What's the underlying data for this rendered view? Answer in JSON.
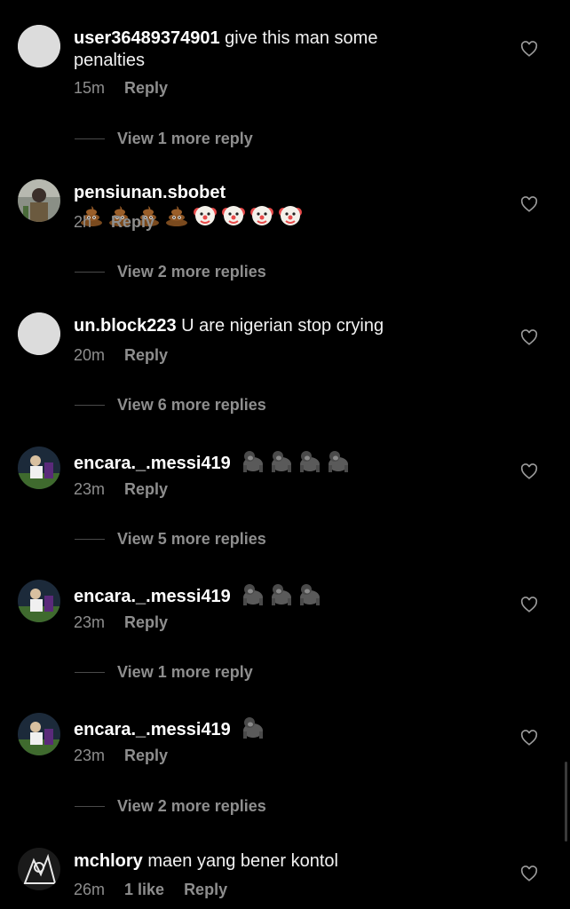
{
  "comments": [
    {
      "username": "user36489374901",
      "text": "give this man some penalties",
      "time": "15m",
      "likes": "",
      "reply_label": "Reply",
      "avatar": "default-avatar",
      "emojis": [],
      "view_more": "View 1 more reply"
    },
    {
      "username": "pensiunan.sbobet",
      "text": "",
      "time": "2h",
      "likes": "",
      "reply_label": "Reply",
      "avatar": "photo-avatar",
      "emojis": [
        "poop-emoji",
        "poop-emoji",
        "poop-emoji",
        "poop-emoji",
        "clown-emoji",
        "clown-emoji",
        "clown-emoji",
        "clown-emoji"
      ],
      "view_more": "View 2 more replies"
    },
    {
      "username": "un.block223",
      "text": "U are nigerian stop crying",
      "time": "20m",
      "likes": "",
      "reply_label": "Reply",
      "avatar": "default-avatar",
      "emojis": [],
      "view_more": "View 6 more replies"
    },
    {
      "username": "encara._.messi419",
      "text": "",
      "time": "23m",
      "likes": "",
      "reply_label": "Reply",
      "avatar": "photo-avatar",
      "emojis": [
        "gorilla-emoji",
        "gorilla-emoji",
        "gorilla-emoji",
        "gorilla-emoji"
      ],
      "view_more": "View 5 more replies"
    },
    {
      "username": "encara._.messi419",
      "text": "",
      "time": "23m",
      "likes": "",
      "reply_label": "Reply",
      "avatar": "photo-avatar",
      "emojis": [
        "gorilla-emoji",
        "gorilla-emoji",
        "gorilla-emoji"
      ],
      "view_more": "View 1 more reply"
    },
    {
      "username": "encara._.messi419",
      "text": "",
      "time": "23m",
      "likes": "",
      "reply_label": "Reply",
      "avatar": "photo-avatar",
      "emojis": [
        "gorilla-emoji"
      ],
      "view_more": "View 2 more replies"
    },
    {
      "username": "mchlory",
      "text": "maen yang bener kontol",
      "time": "26m",
      "likes": "1 like",
      "reply_label": "Reply",
      "avatar": "drawing-avatar",
      "emojis": [],
      "view_more": ""
    }
  ],
  "colors": {
    "background": "#000000",
    "muted": "#8e8e8e",
    "text": "#ffffff"
  }
}
